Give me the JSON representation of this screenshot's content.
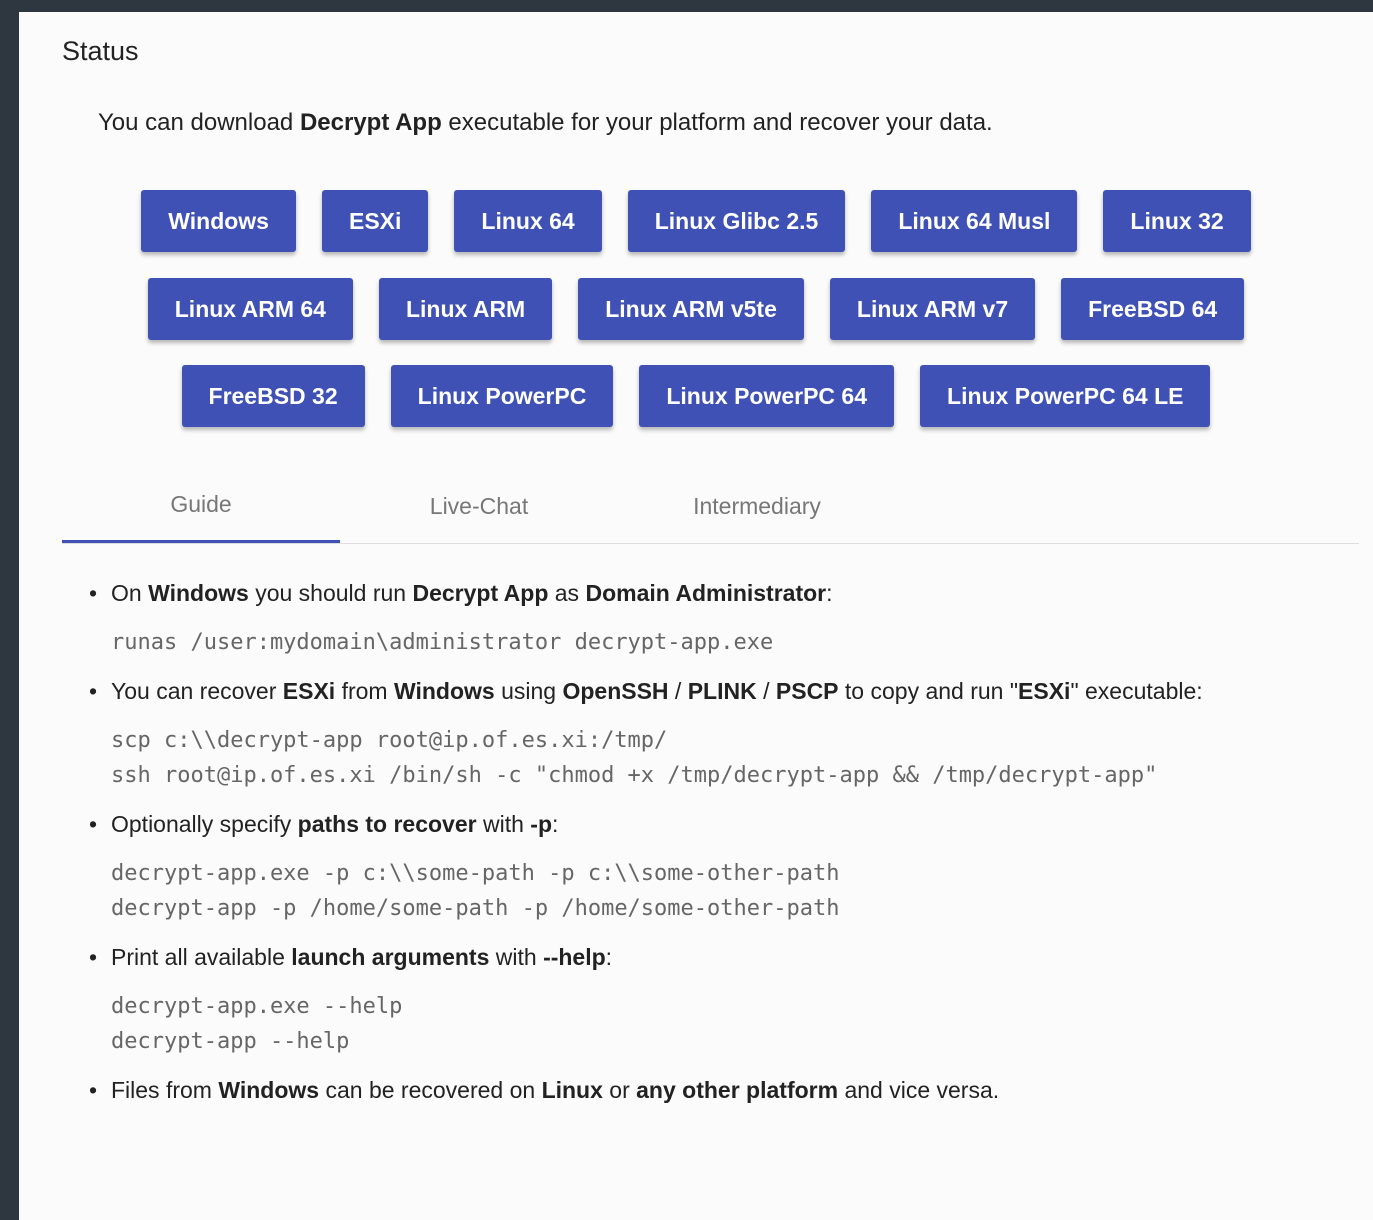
{
  "status_title": "Status",
  "intro": {
    "before": "You can download ",
    "bold": "Decrypt App",
    "after": " executable for your platform and recover your data."
  },
  "buttons": {
    "row1": [
      "Windows",
      "ESXi",
      "Linux 64",
      "Linux Glibc 2.5",
      "Linux 64 Musl",
      "Linux 32"
    ],
    "row2": [
      "Linux ARM 64",
      "Linux ARM",
      "Linux ARM v5te",
      "Linux ARM v7",
      "FreeBSD 64"
    ],
    "row3": [
      "FreeBSD 32",
      "Linux PowerPC",
      "Linux PowerPC 64",
      "Linux PowerPC 64 LE"
    ]
  },
  "tabs": [
    "Guide",
    "Live-Chat",
    "Intermediary"
  ],
  "active_tab": "Guide",
  "accent_color": "#3f51b5",
  "guide": {
    "item1": {
      "t1": "On ",
      "b1": "Windows",
      "t2": " you should run ",
      "b2": "Decrypt App",
      "t3": " as ",
      "b3": "Domain Administrator",
      "t4": ":",
      "code": "runas /user:mydomain\\administrator decrypt-app.exe"
    },
    "item2": {
      "t1": "You can recover ",
      "b1": "ESXi",
      "t2": " from ",
      "b2": "Windows",
      "t3": " using ",
      "b3": "OpenSSH",
      "t4": " / ",
      "b4": "PLINK",
      "t5": " / ",
      "b5": "PSCP",
      "t6": " to copy and run \"",
      "b6": "ESXi",
      "t7": "\" executable:",
      "code1": "scp c:\\\\decrypt-app root@ip.of.es.xi:/tmp/",
      "code2": "ssh root@ip.of.es.xi /bin/sh -c \"chmod +x /tmp/decrypt-app && /tmp/decrypt-app\""
    },
    "item3": {
      "t1": "Optionally specify ",
      "b1": "paths to recover",
      "t2": " with ",
      "b2": "-p",
      "t3": ":",
      "code1": "decrypt-app.exe -p c:\\\\some-path -p c:\\\\some-other-path",
      "code2": "decrypt-app -p /home/some-path -p /home/some-other-path"
    },
    "item4": {
      "t1": "Print all available ",
      "b1": "launch arguments",
      "t2": " with ",
      "b2": "--help",
      "t3": ":",
      "code1": "decrypt-app.exe --help",
      "code2": "decrypt-app --help"
    },
    "item5": {
      "t1": "Files from ",
      "b1": "Windows",
      "t2": " can be recovered on ",
      "b2": "Linux",
      "t3": " or ",
      "b3": "any other platform",
      "t4": " and vice versa."
    }
  }
}
